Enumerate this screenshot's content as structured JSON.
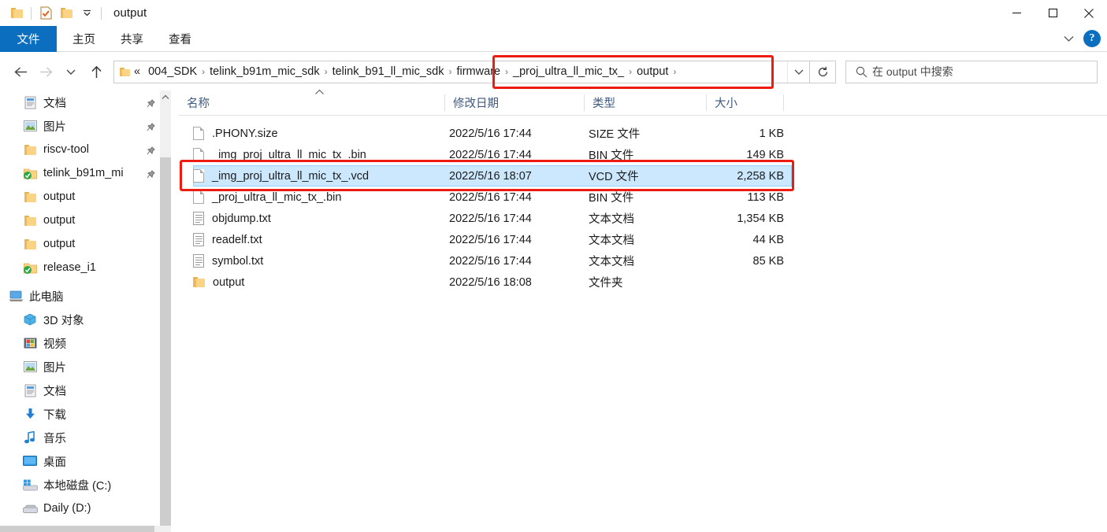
{
  "window": {
    "title": "output",
    "quick_access": [
      {
        "name": "folder-icon",
        "label": "文件资源管理器"
      },
      {
        "name": "properties-icon",
        "label": "属性"
      },
      {
        "name": "new-folder-icon",
        "label": "新建文件夹"
      },
      {
        "name": "customize-dropdown",
        "label": "自定义快速访问工具栏"
      }
    ],
    "controls": {
      "minimize": "最小化",
      "maximize": "最大化",
      "close": "关闭"
    }
  },
  "ribbon": {
    "tabs": [
      {
        "label": "文件",
        "active": true
      },
      {
        "label": "主页",
        "active": false
      },
      {
        "label": "共享",
        "active": false
      },
      {
        "label": "查看",
        "active": false
      }
    ],
    "collapse_label": "折叠功能区",
    "help_label": "?"
  },
  "navigation": {
    "back": "后退",
    "forward": "前进",
    "recent": "最近浏览的位置",
    "up": "上移一级",
    "refresh": "刷新"
  },
  "breadcrumb": {
    "overflow": "«",
    "crumbs": [
      {
        "label": "004_SDK",
        "highlighted": false
      },
      {
        "label": "telink_b91m_mic_sdk",
        "highlighted": false
      },
      {
        "label": "telink_b91_ll_mic_sdk",
        "highlighted": false
      },
      {
        "label": "firmware",
        "highlighted": true
      },
      {
        "label": "_proj_ultra_ll_mic_tx_",
        "highlighted": true
      },
      {
        "label": "output",
        "highlighted": true
      }
    ],
    "separator": "›",
    "dropdown_label": "以前的位置"
  },
  "search": {
    "placeholder": "在 output 中搜索",
    "value": "",
    "icon": "search-icon"
  },
  "sidebar": {
    "items": [
      {
        "label": "文档",
        "icon": "documents-icon",
        "pinned": true,
        "indent": "child"
      },
      {
        "label": "图片",
        "icon": "pictures-icon",
        "pinned": true,
        "indent": "child"
      },
      {
        "label": "riscv-tool",
        "icon": "folder-icon",
        "pinned": true,
        "indent": "child"
      },
      {
        "label": "telink_b91m_mi",
        "icon": "sync-folder-icon",
        "pinned": true,
        "indent": "child"
      },
      {
        "label": "output",
        "icon": "folder-icon",
        "pinned": false,
        "indent": "child"
      },
      {
        "label": "output",
        "icon": "folder-icon",
        "pinned": false,
        "indent": "child"
      },
      {
        "label": "output",
        "icon": "folder-icon",
        "pinned": false,
        "indent": "child"
      },
      {
        "label": "release_i1",
        "icon": "sync-folder-icon",
        "pinned": false,
        "indent": "child"
      },
      {
        "label": "此电脑",
        "icon": "this-pc-icon",
        "pinned": false,
        "indent": "root"
      },
      {
        "label": "3D 对象",
        "icon": "3d-objects-icon",
        "pinned": false,
        "indent": "child"
      },
      {
        "label": "视频",
        "icon": "videos-icon",
        "pinned": false,
        "indent": "child"
      },
      {
        "label": "图片",
        "icon": "pictures-icon",
        "pinned": false,
        "indent": "child"
      },
      {
        "label": "文档",
        "icon": "documents-icon",
        "pinned": false,
        "indent": "child"
      },
      {
        "label": "下载",
        "icon": "downloads-icon",
        "pinned": false,
        "indent": "child"
      },
      {
        "label": "音乐",
        "icon": "music-icon",
        "pinned": false,
        "indent": "child"
      },
      {
        "label": "桌面",
        "icon": "desktop-icon",
        "pinned": false,
        "indent": "child"
      },
      {
        "label": "本地磁盘 (C:)",
        "icon": "system-drive-icon",
        "pinned": false,
        "indent": "child"
      },
      {
        "label": "Daily (D:)",
        "icon": "drive-icon",
        "pinned": false,
        "indent": "child"
      }
    ]
  },
  "file_list": {
    "columns": [
      {
        "label": "名称",
        "key": "name"
      },
      {
        "label": "修改日期",
        "key": "date"
      },
      {
        "label": "类型",
        "key": "type"
      },
      {
        "label": "大小",
        "key": "size"
      }
    ],
    "sort_column": "名称",
    "sort_direction": "ascending",
    "rows": [
      {
        "name": ".PHONY.size",
        "date": "2022/5/16 17:44",
        "type": "SIZE 文件",
        "size": "1 KB",
        "icon": "generic-file-icon",
        "selected": false
      },
      {
        "name": "_img_proj_ultra_ll_mic_tx_.bin",
        "date": "2022/5/16 17:44",
        "type": "BIN 文件",
        "size": "149 KB",
        "icon": "generic-file-icon",
        "selected": false
      },
      {
        "name": "_img_proj_ultra_ll_mic_tx_.vcd",
        "date": "2022/5/16 18:07",
        "type": "VCD 文件",
        "size": "2,258 KB",
        "icon": "generic-file-icon",
        "selected": true
      },
      {
        "name": "_proj_ultra_ll_mic_tx_.bin",
        "date": "2022/5/16 17:44",
        "type": "BIN 文件",
        "size": "113 KB",
        "icon": "generic-file-icon",
        "selected": false
      },
      {
        "name": "objdump.txt",
        "date": "2022/5/16 17:44",
        "type": "文本文档",
        "size": "1,354 KB",
        "icon": "text-file-icon",
        "selected": false
      },
      {
        "name": "readelf.txt",
        "date": "2022/5/16 17:44",
        "type": "文本文档",
        "size": "44 KB",
        "icon": "text-file-icon",
        "selected": false
      },
      {
        "name": "symbol.txt",
        "date": "2022/5/16 17:44",
        "type": "文本文档",
        "size": "85 KB",
        "icon": "text-file-icon",
        "selected": false
      },
      {
        "name": "output",
        "date": "2022/5/16 18:08",
        "type": "文件夹",
        "size": "",
        "icon": "folder-icon",
        "selected": false
      }
    ]
  },
  "annotations": [
    {
      "name": "breadcrumb-highlight",
      "color": "#ee1c10",
      "target": "firmware › _proj_ultra_ll_mic_tx_ › output"
    },
    {
      "name": "selected-file-highlight",
      "color": "#ee1c10",
      "target": "_img_proj_ultra_ll_mic_tx_.vcd"
    }
  ],
  "colors": {
    "accent": "#0b6ebf",
    "selection": "#cce8ff",
    "annotation": "#ee1c10",
    "header_text": "#3d5a80"
  }
}
